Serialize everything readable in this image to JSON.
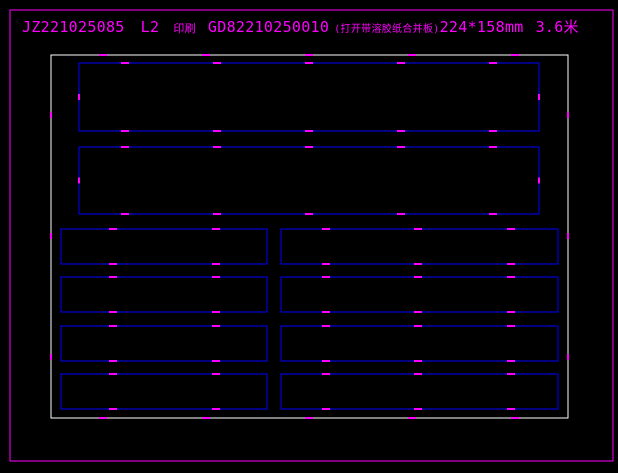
{
  "colors": {
    "background": "#000000",
    "outer_border": "#ff00ff",
    "sheet_border": "#ffffff",
    "panel_outline": "#0000ff",
    "markers": "#ff00ff",
    "title_text": "#ff00ff"
  },
  "title": {
    "job_code": "JZ221025085",
    "layer": "L2",
    "print_label": "印刷",
    "part_code": "GD82210250010",
    "note": "(打开带溶胶纸合并板)",
    "size": "224*158mm",
    "thickness": "3.6米"
  },
  "panel_layout": {
    "large_panels": 2,
    "small_panel_rows": 4,
    "small_panel_columns": 2
  }
}
